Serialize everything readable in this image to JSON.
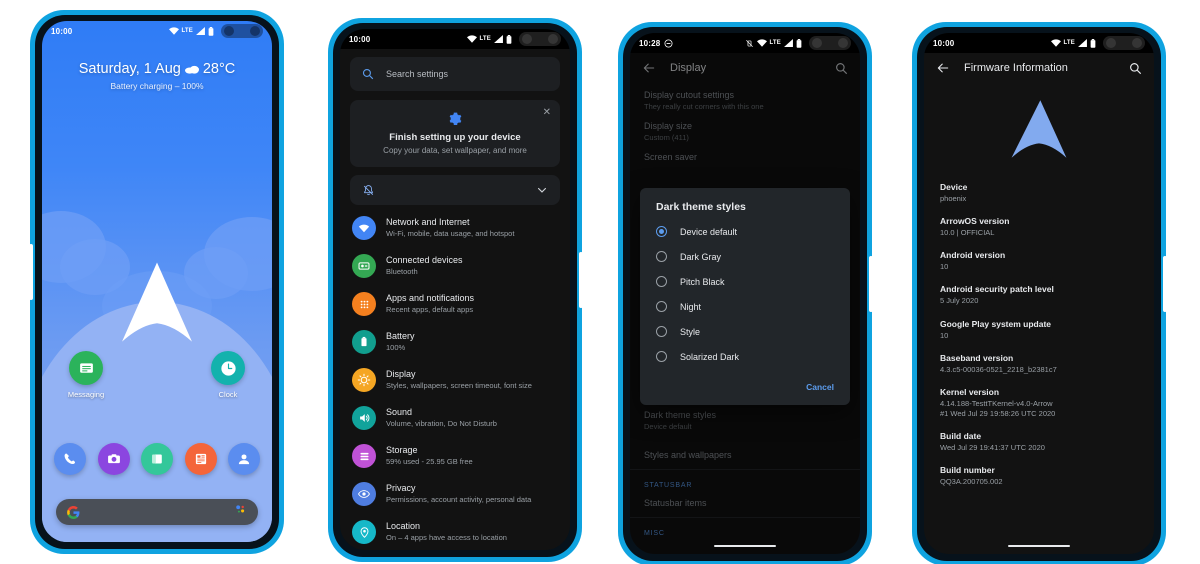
{
  "theme": {
    "frame_color": "#0fa3e0",
    "accent_blue": "#5c9ced",
    "dark_bg": "#121212",
    "card_bg": "#1d1f22",
    "text_primary": "#e8eaed",
    "text_secondary": "#9aa0a6"
  },
  "phone1": {
    "name": "home-screen",
    "statusbar": {
      "clock": "10:00",
      "network": "LTE"
    },
    "wallpaper_name": "arrowos-arrow-wallpaper",
    "clock_widget": {
      "date": "Saturday, 1 Aug",
      "weather_icon": "cloud-icon",
      "temperature": "28°C"
    },
    "battery_status": "Battery charging – 100%",
    "apps": [
      {
        "label": "Messaging",
        "icon": "messaging-icon",
        "color": "#2bb35b"
      },
      {
        "label": "Clock",
        "icon": "clock-icon",
        "color": "#13b2ad"
      }
    ],
    "dock": [
      {
        "label": "Phone",
        "icon": "phone-icon",
        "color": "#5b8def"
      },
      {
        "label": "Camera",
        "icon": "camera-icon",
        "color": "#8b46e0"
      },
      {
        "label": "Files",
        "icon": "files-icon",
        "color": "#34c79a"
      },
      {
        "label": "Calculator",
        "icon": "calculator-icon",
        "color": "#f4653a"
      },
      {
        "label": "Contacts",
        "icon": "contacts-icon",
        "color": "#5b8def"
      }
    ],
    "search": {
      "icon": "google-g-icon",
      "assistant_icon": "google-assistant-icon"
    }
  },
  "phone2": {
    "name": "settings-screen",
    "statusbar": {
      "clock": "10:00",
      "network": "LTE"
    },
    "search": {
      "placeholder": "Search settings",
      "icon": "search-icon"
    },
    "suggestion_card": {
      "icon": "gear-icon",
      "title": "Finish setting up your device",
      "subtitle": "Copy your data, set wallpaper, and more",
      "close_icon": "close-icon"
    },
    "collapse_row": {
      "icon": "bell-off-icon",
      "chevron": "chevron-down-icon"
    },
    "items": [
      {
        "title": "Network and Internet",
        "subtitle": "Wi-Fi, mobile, data usage, and hotspot",
        "icon": "wifi-icon",
        "color": "#4285f4"
      },
      {
        "title": "Connected devices",
        "subtitle": "Bluetooth",
        "icon": "connected-devices-icon",
        "color": "#34a853"
      },
      {
        "title": "Apps and notifications",
        "subtitle": "Recent apps, default apps",
        "icon": "apps-grid-icon",
        "color": "#f4801f"
      },
      {
        "title": "Battery",
        "subtitle": "100%",
        "icon": "battery-icon",
        "color": "#119e8e"
      },
      {
        "title": "Display",
        "subtitle": "Styles, wallpapers, screen timeout, font size",
        "icon": "display-brightness-icon",
        "color": "#f5a623"
      },
      {
        "title": "Sound",
        "subtitle": "Volume, vibration, Do Not Disturb",
        "icon": "sound-icon",
        "color": "#11a39b"
      },
      {
        "title": "Storage",
        "subtitle": "59% used - 25.95 GB free",
        "icon": "storage-icon",
        "color": "#c052d6"
      },
      {
        "title": "Privacy",
        "subtitle": "Permissions, account activity, personal data",
        "icon": "privacy-eye-icon",
        "color": "#4f7de0"
      },
      {
        "title": "Location",
        "subtitle": "On – 4 apps have access to location",
        "icon": "location-pin-icon",
        "color": "#16b8c8"
      }
    ]
  },
  "phone3": {
    "name": "display-settings-dialog",
    "statusbar": {
      "clock": "10:28",
      "dnd_icon": "do-not-disturb-icon",
      "vibrate_icon": "vibrate-off-icon",
      "network": "LTE"
    },
    "appbar": {
      "back_icon": "back-arrow-icon",
      "title": "Display",
      "search_icon": "search-icon"
    },
    "background_items": [
      {
        "title": "Display cutout settings",
        "subtitle": "They really cut corners with this one"
      },
      {
        "title": "Display size",
        "subtitle": "Custom (411)"
      },
      {
        "title": "Screen saver",
        "subtitle": ""
      }
    ],
    "background_items_below": [
      {
        "title": "Dark theme styles",
        "subtitle": "Device default"
      },
      {
        "title": "Styles and wallpapers",
        "subtitle": ""
      }
    ],
    "section_statusbar": "STATUSBAR",
    "statusbar_item": "Statusbar items",
    "section_misc": "MISC",
    "dialog": {
      "title": "Dark theme styles",
      "options": [
        {
          "label": "Device default",
          "selected": true
        },
        {
          "label": "Dark Gray",
          "selected": false
        },
        {
          "label": "Pitch Black",
          "selected": false
        },
        {
          "label": "Night",
          "selected": false
        },
        {
          "label": "Style",
          "selected": false
        },
        {
          "label": "Solarized Dark",
          "selected": false
        }
      ],
      "cancel_label": "Cancel"
    }
  },
  "phone4": {
    "name": "firmware-information-screen",
    "statusbar": {
      "clock": "10:00",
      "network": "LTE"
    },
    "appbar": {
      "back_icon": "back-arrow-icon",
      "title": "Firmware Information",
      "search_icon": "search-icon"
    },
    "logo_name": "arrowos-logo",
    "rows": [
      {
        "title": "Device",
        "value": "phoenix"
      },
      {
        "title": "ArrowOS version",
        "value": "10.0 | OFFICIAL"
      },
      {
        "title": "Android version",
        "value": "10"
      },
      {
        "title": "Android security patch level",
        "value": "5 July 2020"
      },
      {
        "title": "Google Play system update",
        "value": "10"
      },
      {
        "title": "Baseband version",
        "value": "4.3.c5-00036-0521_2218_b2381c7"
      },
      {
        "title": "Kernel version",
        "value": "4.14.188-TesttTKernel-v4.0-Arrow\n#1 Wed Jul 29 19:58:26 UTC 2020"
      },
      {
        "title": "Build date",
        "value": "Wed Jul 29 19:41:37 UTC 2020"
      },
      {
        "title": "Build number",
        "value": "QQ3A.200705.002"
      }
    ]
  }
}
